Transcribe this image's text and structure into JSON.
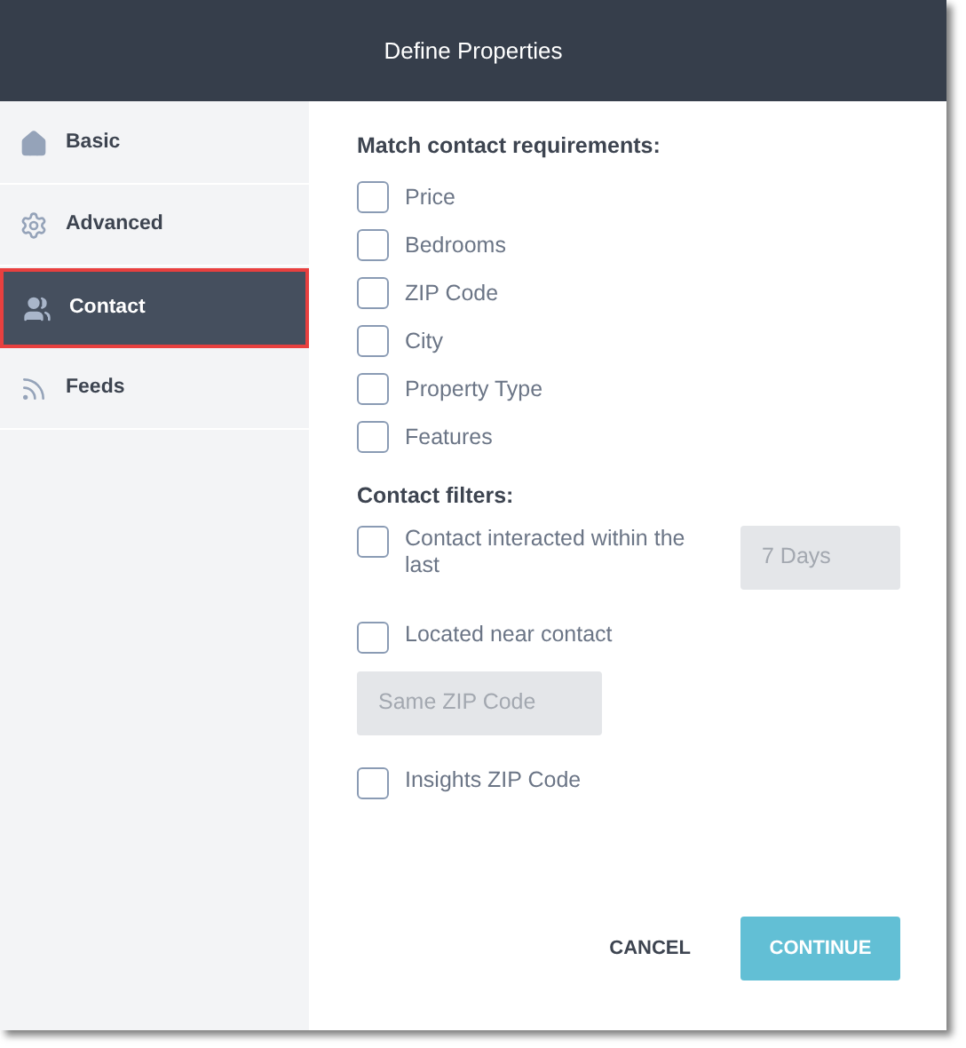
{
  "window": {
    "title": "Define Properties"
  },
  "sidebar": {
    "items": [
      {
        "label": "Basic",
        "selected": false
      },
      {
        "label": "Advanced",
        "selected": false
      },
      {
        "label": "Contact",
        "selected": true
      },
      {
        "label": "Feeds",
        "selected": false
      }
    ]
  },
  "requirements": {
    "heading": "Match contact requirements:",
    "options": [
      {
        "label": "Price",
        "checked": false
      },
      {
        "label": "Bedrooms",
        "checked": false
      },
      {
        "label": "ZIP Code",
        "checked": false
      },
      {
        "label": "City",
        "checked": false
      },
      {
        "label": "Property Type",
        "checked": false
      },
      {
        "label": "Features",
        "checked": false
      }
    ]
  },
  "filters": {
    "heading": "Contact filters:",
    "items": [
      {
        "kind": "checkbox_field",
        "label": "Contact interacted within the last",
        "checked": false,
        "field": "7 Days"
      },
      {
        "kind": "checkbox",
        "label": "Located near contact",
        "checked": false
      },
      {
        "kind": "field",
        "field": "Same ZIP Code"
      },
      {
        "kind": "checkbox",
        "label": "Insights ZIP Code",
        "checked": false
      }
    ]
  },
  "buttons": {
    "cancel": "CANCEL",
    "continue": "CONTINUE"
  }
}
